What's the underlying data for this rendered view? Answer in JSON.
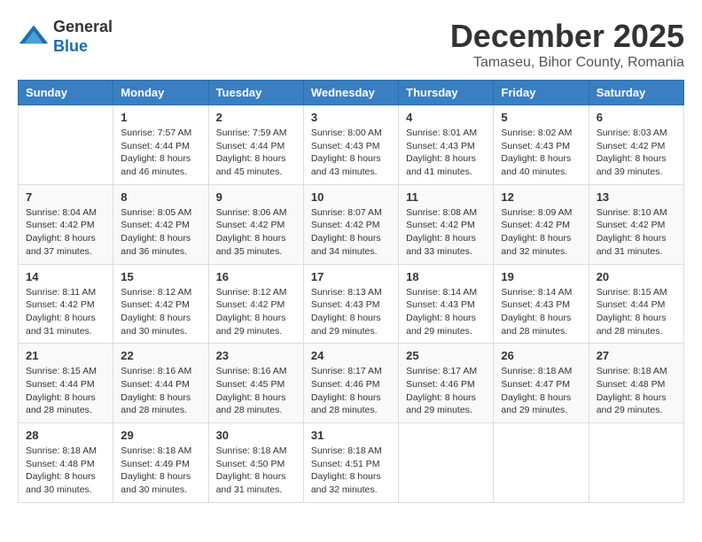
{
  "logo": {
    "general": "General",
    "blue": "Blue"
  },
  "header": {
    "month": "December 2025",
    "location": "Tamaseu, Bihor County, Romania"
  },
  "weekdays": [
    "Sunday",
    "Monday",
    "Tuesday",
    "Wednesday",
    "Thursday",
    "Friday",
    "Saturday"
  ],
  "weeks": [
    [
      {
        "day": "",
        "sunrise": "",
        "sunset": "",
        "daylight": ""
      },
      {
        "day": "1",
        "sunrise": "Sunrise: 7:57 AM",
        "sunset": "Sunset: 4:44 PM",
        "daylight": "Daylight: 8 hours and 46 minutes."
      },
      {
        "day": "2",
        "sunrise": "Sunrise: 7:59 AM",
        "sunset": "Sunset: 4:44 PM",
        "daylight": "Daylight: 8 hours and 45 minutes."
      },
      {
        "day": "3",
        "sunrise": "Sunrise: 8:00 AM",
        "sunset": "Sunset: 4:43 PM",
        "daylight": "Daylight: 8 hours and 43 minutes."
      },
      {
        "day": "4",
        "sunrise": "Sunrise: 8:01 AM",
        "sunset": "Sunset: 4:43 PM",
        "daylight": "Daylight: 8 hours and 41 minutes."
      },
      {
        "day": "5",
        "sunrise": "Sunrise: 8:02 AM",
        "sunset": "Sunset: 4:43 PM",
        "daylight": "Daylight: 8 hours and 40 minutes."
      },
      {
        "day": "6",
        "sunrise": "Sunrise: 8:03 AM",
        "sunset": "Sunset: 4:42 PM",
        "daylight": "Daylight: 8 hours and 39 minutes."
      }
    ],
    [
      {
        "day": "7",
        "sunrise": "Sunrise: 8:04 AM",
        "sunset": "Sunset: 4:42 PM",
        "daylight": "Daylight: 8 hours and 37 minutes."
      },
      {
        "day": "8",
        "sunrise": "Sunrise: 8:05 AM",
        "sunset": "Sunset: 4:42 PM",
        "daylight": "Daylight: 8 hours and 36 minutes."
      },
      {
        "day": "9",
        "sunrise": "Sunrise: 8:06 AM",
        "sunset": "Sunset: 4:42 PM",
        "daylight": "Daylight: 8 hours and 35 minutes."
      },
      {
        "day": "10",
        "sunrise": "Sunrise: 8:07 AM",
        "sunset": "Sunset: 4:42 PM",
        "daylight": "Daylight: 8 hours and 34 minutes."
      },
      {
        "day": "11",
        "sunrise": "Sunrise: 8:08 AM",
        "sunset": "Sunset: 4:42 PM",
        "daylight": "Daylight: 8 hours and 33 minutes."
      },
      {
        "day": "12",
        "sunrise": "Sunrise: 8:09 AM",
        "sunset": "Sunset: 4:42 PM",
        "daylight": "Daylight: 8 hours and 32 minutes."
      },
      {
        "day": "13",
        "sunrise": "Sunrise: 8:10 AM",
        "sunset": "Sunset: 4:42 PM",
        "daylight": "Daylight: 8 hours and 31 minutes."
      }
    ],
    [
      {
        "day": "14",
        "sunrise": "Sunrise: 8:11 AM",
        "sunset": "Sunset: 4:42 PM",
        "daylight": "Daylight: 8 hours and 31 minutes."
      },
      {
        "day": "15",
        "sunrise": "Sunrise: 8:12 AM",
        "sunset": "Sunset: 4:42 PM",
        "daylight": "Daylight: 8 hours and 30 minutes."
      },
      {
        "day": "16",
        "sunrise": "Sunrise: 8:12 AM",
        "sunset": "Sunset: 4:42 PM",
        "daylight": "Daylight: 8 hours and 29 minutes."
      },
      {
        "day": "17",
        "sunrise": "Sunrise: 8:13 AM",
        "sunset": "Sunset: 4:43 PM",
        "daylight": "Daylight: 8 hours and 29 minutes."
      },
      {
        "day": "18",
        "sunrise": "Sunrise: 8:14 AM",
        "sunset": "Sunset: 4:43 PM",
        "daylight": "Daylight: 8 hours and 29 minutes."
      },
      {
        "day": "19",
        "sunrise": "Sunrise: 8:14 AM",
        "sunset": "Sunset: 4:43 PM",
        "daylight": "Daylight: 8 hours and 28 minutes."
      },
      {
        "day": "20",
        "sunrise": "Sunrise: 8:15 AM",
        "sunset": "Sunset: 4:44 PM",
        "daylight": "Daylight: 8 hours and 28 minutes."
      }
    ],
    [
      {
        "day": "21",
        "sunrise": "Sunrise: 8:15 AM",
        "sunset": "Sunset: 4:44 PM",
        "daylight": "Daylight: 8 hours and 28 minutes."
      },
      {
        "day": "22",
        "sunrise": "Sunrise: 8:16 AM",
        "sunset": "Sunset: 4:44 PM",
        "daylight": "Daylight: 8 hours and 28 minutes."
      },
      {
        "day": "23",
        "sunrise": "Sunrise: 8:16 AM",
        "sunset": "Sunset: 4:45 PM",
        "daylight": "Daylight: 8 hours and 28 minutes."
      },
      {
        "day": "24",
        "sunrise": "Sunrise: 8:17 AM",
        "sunset": "Sunset: 4:46 PM",
        "daylight": "Daylight: 8 hours and 28 minutes."
      },
      {
        "day": "25",
        "sunrise": "Sunrise: 8:17 AM",
        "sunset": "Sunset: 4:46 PM",
        "daylight": "Daylight: 8 hours and 29 minutes."
      },
      {
        "day": "26",
        "sunrise": "Sunrise: 8:18 AM",
        "sunset": "Sunset: 4:47 PM",
        "daylight": "Daylight: 8 hours and 29 minutes."
      },
      {
        "day": "27",
        "sunrise": "Sunrise: 8:18 AM",
        "sunset": "Sunset: 4:48 PM",
        "daylight": "Daylight: 8 hours and 29 minutes."
      }
    ],
    [
      {
        "day": "28",
        "sunrise": "Sunrise: 8:18 AM",
        "sunset": "Sunset: 4:48 PM",
        "daylight": "Daylight: 8 hours and 30 minutes."
      },
      {
        "day": "29",
        "sunrise": "Sunrise: 8:18 AM",
        "sunset": "Sunset: 4:49 PM",
        "daylight": "Daylight: 8 hours and 30 minutes."
      },
      {
        "day": "30",
        "sunrise": "Sunrise: 8:18 AM",
        "sunset": "Sunset: 4:50 PM",
        "daylight": "Daylight: 8 hours and 31 minutes."
      },
      {
        "day": "31",
        "sunrise": "Sunrise: 8:18 AM",
        "sunset": "Sunset: 4:51 PM",
        "daylight": "Daylight: 8 hours and 32 minutes."
      },
      {
        "day": "",
        "sunrise": "",
        "sunset": "",
        "daylight": ""
      },
      {
        "day": "",
        "sunrise": "",
        "sunset": "",
        "daylight": ""
      },
      {
        "day": "",
        "sunrise": "",
        "sunset": "",
        "daylight": ""
      }
    ]
  ]
}
